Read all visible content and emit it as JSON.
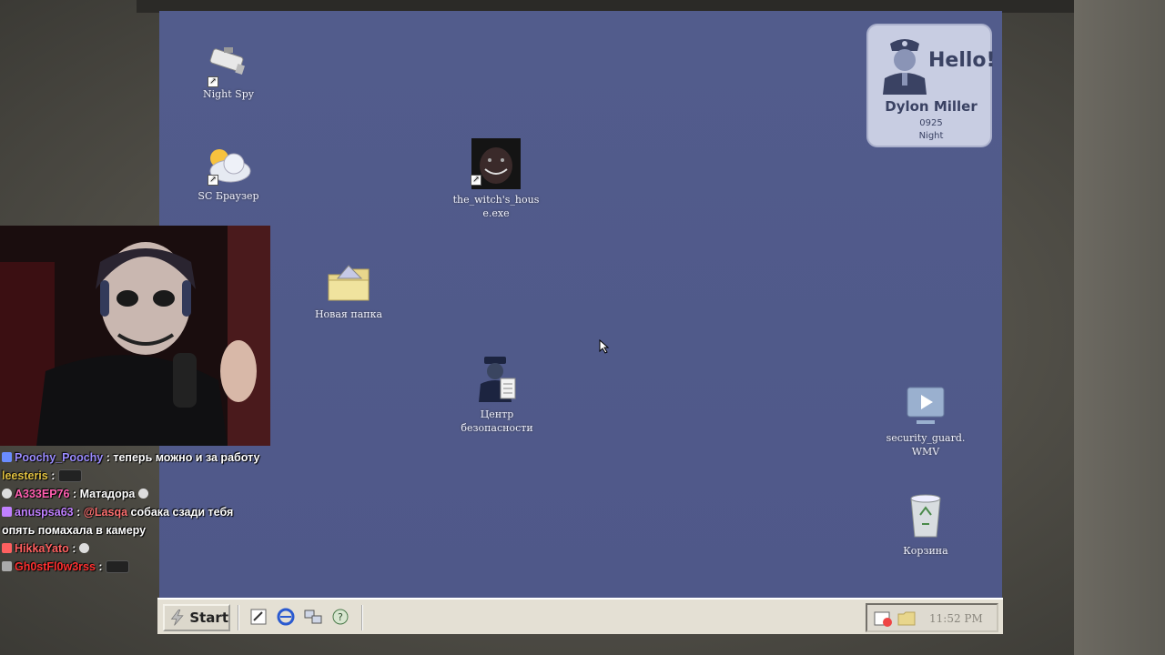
{
  "desktop": {
    "icons": [
      {
        "label": "Night Spy"
      },
      {
        "label": "SC Браузер"
      },
      {
        "label": "the_witch's_house.exe"
      },
      {
        "label": "Новая папка"
      },
      {
        "label": "Центр безопасности"
      },
      {
        "label": "security_guard.WMV"
      },
      {
        "label": "Корзина"
      }
    ]
  },
  "welcome_card": {
    "greeting": "Hello!",
    "name": "Dylon Miller",
    "code": "0925",
    "shift": "Night"
  },
  "taskbar": {
    "start_label": "Start",
    "clock": "11:52 PM"
  },
  "chat": {
    "messages": [
      {
        "user": "Poochy_Poochy",
        "user_color": "#9b8cff",
        "text": "теперь можно и за работу"
      },
      {
        "user": "leesteris",
        "user_color": "#e0c040",
        "text": ""
      },
      {
        "user": "A333EP76",
        "user_color": "#ff5fb0",
        "text": "Матадора"
      },
      {
        "user": "anuspsa63",
        "user_color": "#c080ff",
        "mention": "@Lasqa",
        "text": "собака сзади тебя опять помахала в камеру"
      },
      {
        "user": "HikkaYato",
        "user_color": "#ff6060",
        "text": ""
      },
      {
        "user": "Gh0stFl0w3rss",
        "user_color": "#ff3030",
        "text": ""
      }
    ]
  },
  "colors": {
    "desktop_bg": "#505a8a",
    "card_bg": "#c8cde2",
    "taskbar_bg": "#e4e0d4"
  }
}
